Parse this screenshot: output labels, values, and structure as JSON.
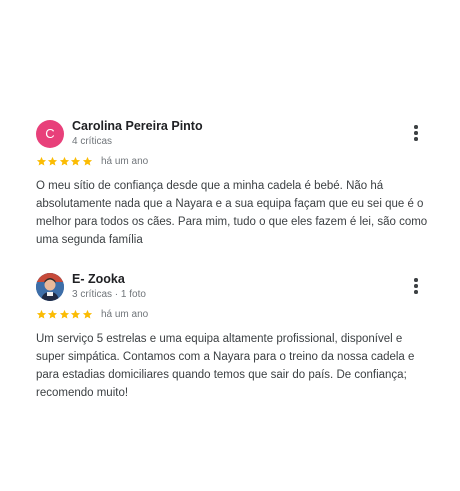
{
  "colors": {
    "star": "#fbbc04",
    "avatar_1": "#e8407a",
    "text": "#3c4043",
    "meta": "#70757a"
  },
  "reviews": [
    {
      "avatar_letter": "C",
      "author": "Carolina Pereira Pinto",
      "meta": "4 críticas",
      "rating": 5,
      "time": "há um ano",
      "text": "O meu sítio de confiança desde que a minha cadela é bebé. Não há absolutamente nada que a Nayara e a sua equipa façam que eu sei que é o melhor para todos os cães. Para mim, tudo o que eles fazem é lei, são como uma segunda família",
      "more_icon": "more-vert-icon"
    },
    {
      "avatar_icon": "user-photo",
      "author": "E- Zooka",
      "meta": "3 críticas · 1 foto",
      "rating": 5,
      "time": "há um ano",
      "text": "Um serviço 5 estrelas e uma equipa altamente profissional, disponível e super simpática. Contamos com a Nayara para o treino da nossa cadela e para estadias domiciliares quando temos que sair do país. De confiança; recomendo muito!",
      "more_icon": "more-vert-icon"
    }
  ]
}
